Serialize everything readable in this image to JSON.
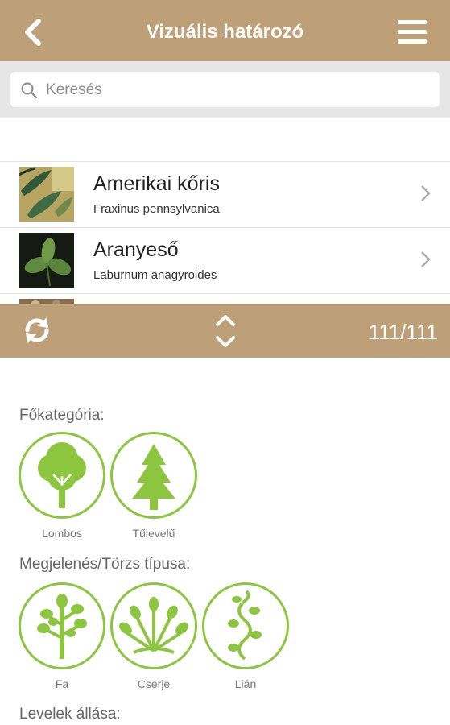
{
  "header": {
    "title": "Vizuális határozó",
    "back_icon": "back-chevron-icon",
    "menu_icon": "hamburger-menu-icon"
  },
  "search": {
    "placeholder": "Keresés",
    "value": ""
  },
  "plants": [
    {
      "name": "Amerikai kőris",
      "latin": "Fraxinus pennsylvanica",
      "thumb": "ash-leaves-photo"
    },
    {
      "name": "Aranyeső",
      "latin": "Laburnum anagyroides",
      "thumb": "laburnum-leaves-photo"
    }
  ],
  "toolbar": {
    "count": "111/111",
    "refresh_icon": "refresh-icon",
    "sort_icon": "sort-updown-icon"
  },
  "filters": {
    "main_category": {
      "label": "Főkategória:",
      "options": [
        "Lombos",
        "Tűlevelű"
      ]
    },
    "appearance": {
      "label": "Megjelenés/Törzs típusa:",
      "options": [
        "Fa",
        "Cserje",
        "Lián"
      ]
    },
    "leaf_position": {
      "label": "Levelek állása:"
    }
  },
  "colors": {
    "bar": "#bd9f78",
    "accent": "#8cc63f"
  }
}
